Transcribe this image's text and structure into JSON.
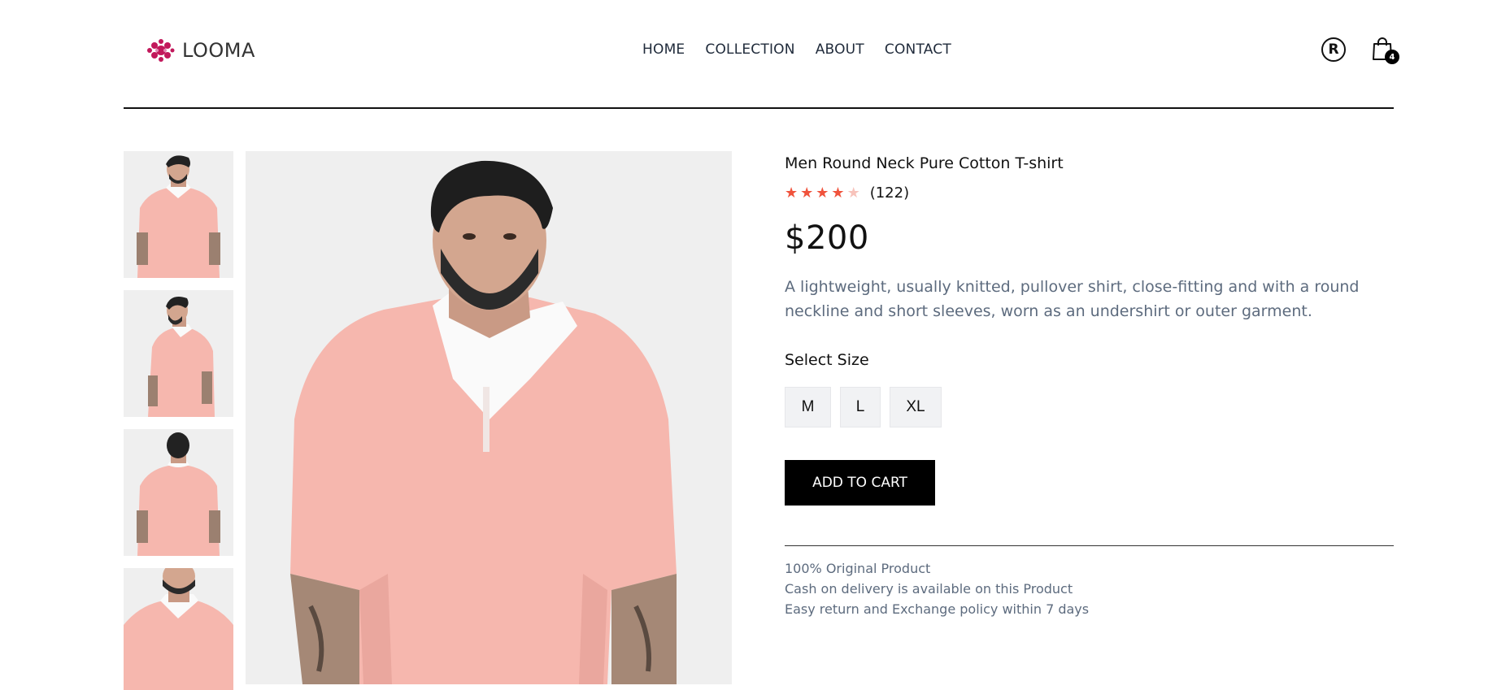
{
  "brand": {
    "name": "LOOMA",
    "logo_color": "#c2185b",
    "logo_icon": "flower-dots-icon"
  },
  "nav": {
    "items": [
      {
        "label": "HOME"
      },
      {
        "label": "COLLECTION"
      },
      {
        "label": "ABOUT"
      },
      {
        "label": "CONTACT"
      }
    ]
  },
  "account": {
    "initial": "R",
    "icon": "user-circle-icon"
  },
  "cart": {
    "count": "4",
    "icon": "shopping-bag-icon"
  },
  "gallery": {
    "thumbnails": [
      {
        "icon": "product-thumbnail-front"
      },
      {
        "icon": "product-thumbnail-side"
      },
      {
        "icon": "product-thumbnail-back"
      },
      {
        "icon": "product-thumbnail-closeup"
      }
    ],
    "main_image": {
      "icon": "product-main-image"
    },
    "shirt_color": "#f6b7ae",
    "background": "#efefef"
  },
  "product": {
    "title": "Men Round Neck Pure Cotton T-shirt",
    "rating": 4,
    "rating_max": 5,
    "reviews": "(122)",
    "price": "$200",
    "description": "A lightweight, usually knitted, pullover shirt, close-fitting and with a round neckline and short sleeves, worn as an undershirt or outer garment.",
    "select_size_label": "Select Size",
    "sizes": [
      "M",
      "L",
      "XL"
    ],
    "add_to_cart_label": "ADD TO CART",
    "star_color": "#f0533c",
    "policies": [
      "100% Original Product",
      "Cash on delivery is available on this Product",
      "Easy return and Exchange policy within 7 days"
    ]
  }
}
